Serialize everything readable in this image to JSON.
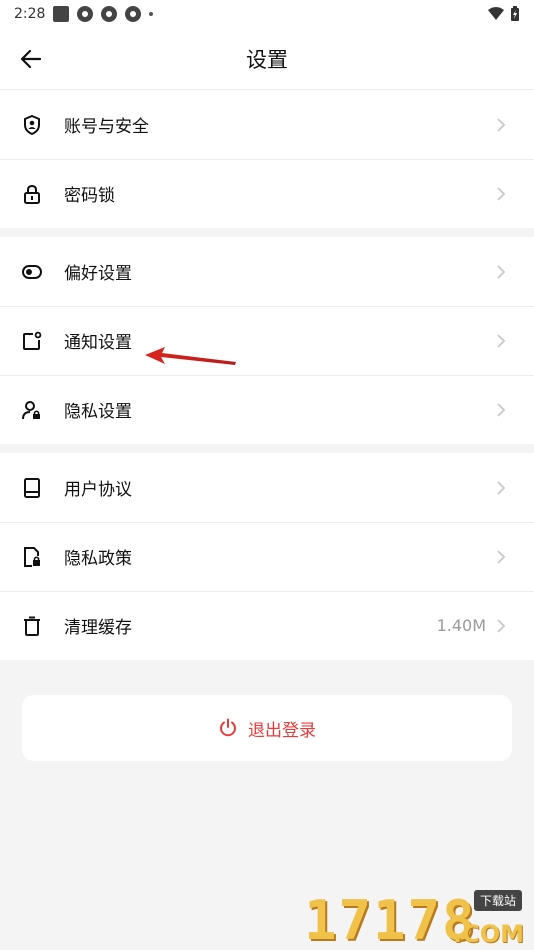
{
  "status_bar": {
    "time": "2:28"
  },
  "header": {
    "title": "设置"
  },
  "groups": [
    {
      "items": [
        {
          "label": "账号与安全",
          "icon": "shield-user-icon"
        },
        {
          "label": "密码锁",
          "icon": "lock-icon"
        }
      ]
    },
    {
      "items": [
        {
          "label": "偏好设置",
          "icon": "toggle-icon"
        },
        {
          "label": "通知设置",
          "icon": "notification-icon"
        },
        {
          "label": "隐私设置",
          "icon": "user-lock-icon"
        }
      ]
    },
    {
      "items": [
        {
          "label": "用户协议",
          "icon": "book-icon"
        },
        {
          "label": "隐私政策",
          "icon": "document-lock-icon"
        },
        {
          "label": "清理缓存",
          "icon": "trash-icon",
          "value": "1.40M"
        }
      ]
    }
  ],
  "logout": {
    "label": "退出登录",
    "icon": "power-icon"
  },
  "colors": {
    "accent_red": "#e93b3b",
    "annotation_red": "#d9261c"
  },
  "watermark": {
    "number": "17178",
    "tag": "下载站",
    "domain": ".COM"
  }
}
